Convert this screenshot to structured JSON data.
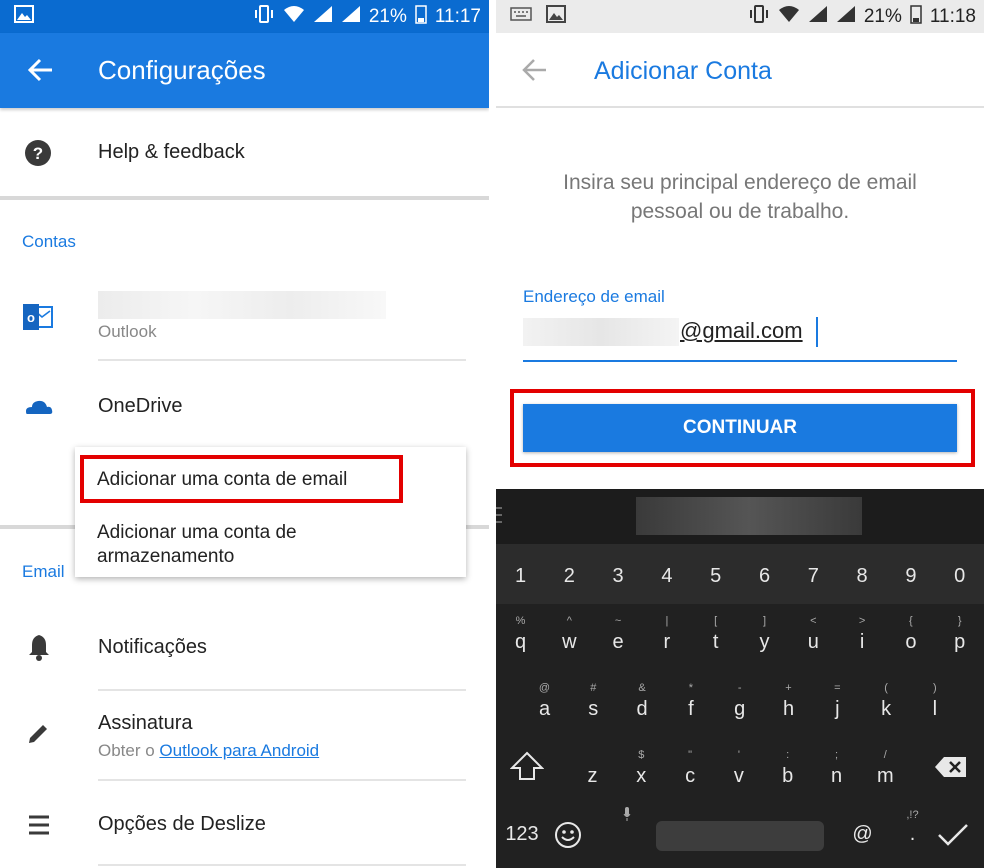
{
  "left": {
    "status": {
      "battery": "21%",
      "time": "11:17"
    },
    "title": "Configurações",
    "help_label": "Help & feedback",
    "section_contas": "Contas",
    "outlook_sub": "Outlook",
    "onedrive_label": "OneDrive",
    "section_email": "Email",
    "menu": {
      "item1": "Adicionar uma conta de email",
      "item2": "Adicionar uma conta de armazenamento"
    },
    "notificacoes": "Notificações",
    "assinatura": "Assinatura",
    "assinatura_sub_prefix": "Obter o ",
    "assinatura_sub_link": "Outlook para Android",
    "opcoes_deslize": "Opções de Deslize"
  },
  "right": {
    "status": {
      "battery": "21%",
      "time": "11:18"
    },
    "title": "Adicionar Conta",
    "instruction": "Insira seu principal endereço de email pessoal ou de trabalho.",
    "email_label": "Endereço de email",
    "email_value": "@gmail.com",
    "continue_label": "CONTINUAR",
    "keyboard": {
      "numbers": [
        "1",
        "2",
        "3",
        "4",
        "5",
        "6",
        "7",
        "8",
        "9",
        "0"
      ],
      "row1": [
        "q",
        "w",
        "e",
        "r",
        "t",
        "y",
        "u",
        "i",
        "o",
        "p"
      ],
      "row1_sup": [
        "%",
        "^",
        "~",
        "|",
        "[",
        "]",
        "<",
        ">",
        "{",
        "}"
      ],
      "row2": [
        "a",
        "s",
        "d",
        "f",
        "g",
        "h",
        "j",
        "k",
        "l"
      ],
      "row2_sup": [
        "@",
        "#",
        "&",
        "*",
        "-",
        "+",
        "=",
        "(",
        ")"
      ],
      "row3": [
        "z",
        "x",
        "c",
        "v",
        "b",
        "n",
        "m"
      ],
      "row3_sup": [
        "",
        "$",
        "\"",
        "'",
        ":",
        ";",
        "/"
      ],
      "mode_label": "123",
      "at_key": "@",
      "punct_sup": ",!?"
    }
  }
}
